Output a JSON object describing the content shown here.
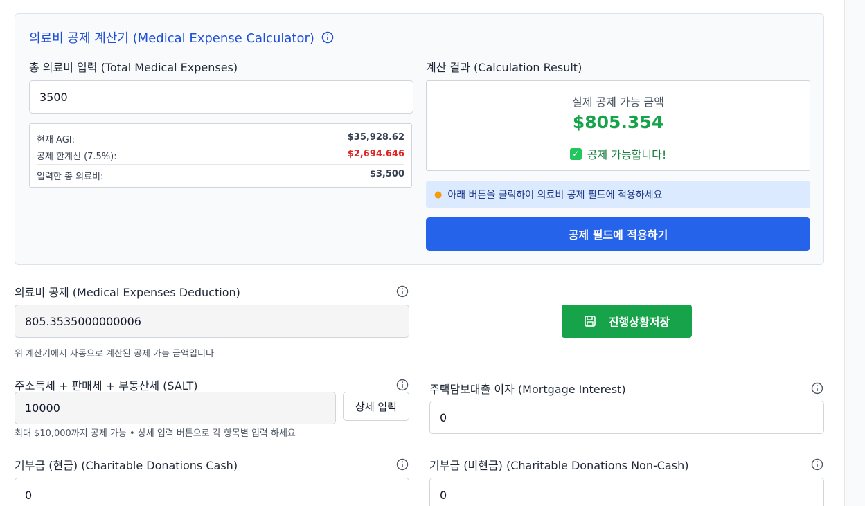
{
  "calculator": {
    "title": "의료비 공제 계산기 (Medical Expense Calculator)",
    "input_label": "총 의료비 입력 (Total Medical Expenses)",
    "input_value": "3500",
    "summary": {
      "agi_label": "현재 AGI:",
      "agi_value": "$35,928.62",
      "threshold_label": "공제 한계선 (7.5%):",
      "threshold_value": "$2,694.646",
      "entered_label": "입력한 총 의료비:",
      "entered_value": "$3,500"
    },
    "result_label": "계산 결과 (Calculation Result)",
    "result_caption": "실제 공제 가능 금액",
    "result_value": "$805.354",
    "result_status": "공제 가능합니다!",
    "hint": "아래 버튼을 클릭하여 의료비 공제 필드에 적용하세요",
    "apply_button": "공제 필드에 적용하기"
  },
  "fields": {
    "medical": {
      "label": "의료비 공제 (Medical Expenses Deduction)",
      "value": "805.3535000000006",
      "helper": "위 계산기에서 자동으로 계산된 공제 가능 금액입니다"
    },
    "save_button": "진행상황저장",
    "salt": {
      "label": "주소득세 + 판매세 + 부동산세 (SALT)",
      "value": "10000",
      "detail_button": "상세 입력",
      "helper": "최대 $10,000까지 공제 가능 • 상세 입력 버튼으로 각 항목별 입력 하세요"
    },
    "mortgage": {
      "label": "주택담보대출 이자 (Mortgage Interest)",
      "value": "0"
    },
    "charity_cash": {
      "label": "기부금 (현금) (Charitable Donations Cash)",
      "value": "0"
    },
    "charity_noncash": {
      "label": "기부금 (비현금) (Charitable Donations Non-Cash)",
      "value": "0"
    }
  },
  "colors": {
    "primary_blue": "#2563eb",
    "title_blue": "#1d4ed8",
    "success_green": "#16a34a",
    "danger_red": "#dc2626"
  },
  "icons": [
    "info-icon",
    "check-icon",
    "lightbulb-icon",
    "save-icon"
  ]
}
